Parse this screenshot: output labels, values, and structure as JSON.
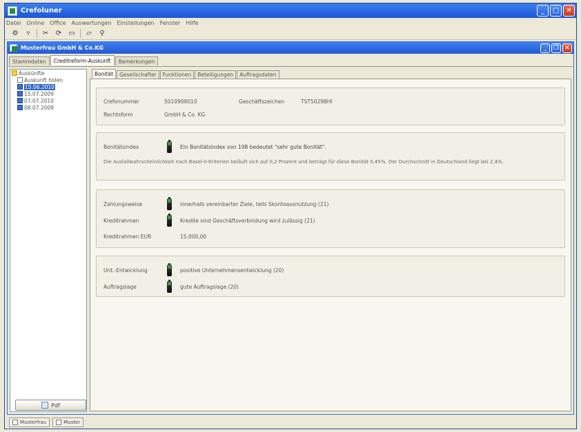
{
  "window": {
    "title": "Crefoluner"
  },
  "menu": [
    "Datei",
    "Online",
    "Office",
    "Auswertungen",
    "Einstellungen",
    "Fenster",
    "Hilfe"
  ],
  "toolbar": {
    "icons": [
      "gear-icon",
      "filter-icon",
      "cut-icon",
      "refresh-icon",
      "window-icon",
      "folder-icon",
      "search-icon"
    ]
  },
  "child": {
    "title": "Musterfrau GmbH & Co.KG"
  },
  "top_tabs": [
    "Stammdaten",
    "Creditreform-Auskunft",
    "Bemerkungen"
  ],
  "tree": {
    "root": "Auskünfte",
    "items": [
      {
        "label": "Auskunft holen",
        "icon": "doc"
      },
      {
        "label": "15.06.2010",
        "icon": "cal",
        "selected": true
      },
      {
        "label": "15.07.2009",
        "icon": "cal"
      },
      {
        "label": "07.07.2010",
        "icon": "cal"
      },
      {
        "label": "08.07.2009",
        "icon": "cal"
      }
    ],
    "pdf_label": "Pdf"
  },
  "inner_tabs": [
    "Bonität",
    "Gesellschafter",
    "Funktionen",
    "Beteiligungen",
    "Auftragsdaten"
  ],
  "panel": {
    "s1": {
      "r1_label": "Crefonummer",
      "r1_value": "5010908010",
      "r1_label2": "Geschäftszeichen",
      "r1_value2": "TST50298HI",
      "r2_label": "Rechtsform",
      "r2_value": "GmbH & Co. KG"
    },
    "s2": {
      "label": "Bonitätsindex",
      "value": "Ein Bonitätsindex von 198 bedeutet \"sehr gute Bonität\".",
      "note": "Die Ausfallwahrscheinlichkeit nach Basel-II-Kriterien beläuft sich auf 0,2 Prozent und beträgt für diese Bonität 0,45%. Der Durchschnitt in Deutschland liegt bei 2,4%."
    },
    "s3": {
      "r1_label": "Zahlungsweise",
      "r1_value": "innerhalb vereinbarter Ziele, teils Skontoausnutzung (21)",
      "r2_label": "Kreditrahmen",
      "r2_value": "Kredite sind Geschäftsverbindung wird zulässig (21)",
      "r3_label": "Kreditrahmen EUR",
      "r3_value": "15.000,00"
    },
    "s4": {
      "r1_label": "Unt.-Entwicklung",
      "r1_value": "positive Unternehmensentwicklung (20)",
      "r2_label": "Auftragslage",
      "r2_value": "gute Auftragslage (20)"
    }
  },
  "taskbar": [
    "Musterfrau",
    "Muster"
  ]
}
